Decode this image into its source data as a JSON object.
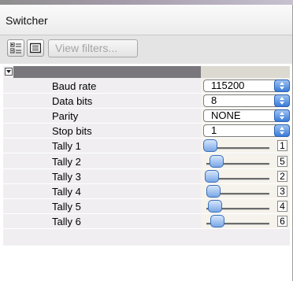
{
  "panel": {
    "title": "Switcher"
  },
  "toolbar": {
    "categorized_icon": "categorized-view-icon",
    "list_icon": "list-view-icon",
    "view_filters_label": "View filters..."
  },
  "properties": [
    {
      "label": "Baud rate",
      "control": "select",
      "value": "115200"
    },
    {
      "label": "Data bits",
      "control": "select",
      "value": "8"
    },
    {
      "label": "Parity",
      "control": "select",
      "value": "NONE"
    },
    {
      "label": "Stop bits",
      "control": "select",
      "value": "1"
    },
    {
      "label": "Tally 1",
      "control": "slider",
      "value": "1",
      "level": 0.0
    },
    {
      "label": "Tally 2",
      "control": "slider",
      "value": "5",
      "level": 0.11
    },
    {
      "label": "Tally 3",
      "control": "slider",
      "value": "2",
      "level": 0.03
    },
    {
      "label": "Tally 4",
      "control": "slider",
      "value": "3",
      "level": 0.05
    },
    {
      "label": "Tally 5",
      "control": "slider",
      "value": "4",
      "level": 0.08
    },
    {
      "label": "Tally 6",
      "control": "slider",
      "value": "6",
      "level": 0.13
    }
  ],
  "colors": {
    "group_header": "#7a777c",
    "row_background": "#f0eef1",
    "accent_blue": "#3a7bd8"
  }
}
